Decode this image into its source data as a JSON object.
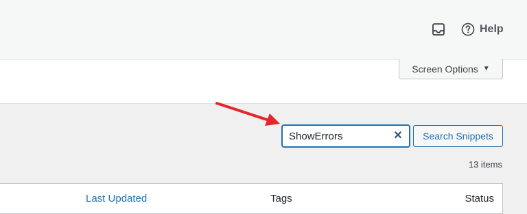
{
  "topbar": {
    "inbox_icon": "inbox-icon",
    "help_icon": "question-circle-icon",
    "help_label": "Help"
  },
  "screen_options": {
    "label": "Screen Options",
    "caret": "▼"
  },
  "annotation": {
    "arrow_color": "#e5242b"
  },
  "search": {
    "value": "ShowErrors",
    "clear_glyph": "✕",
    "button_label": "Search Snippets"
  },
  "items_count": "13 items",
  "table": {
    "columns": [
      {
        "label": "Last Updated",
        "sortable": true
      },
      {
        "label": "Tags",
        "sortable": false
      },
      {
        "label": "Status",
        "sortable": false
      }
    ]
  },
  "colors": {
    "accent": "#2271b1",
    "background": "#f0f0f1"
  }
}
